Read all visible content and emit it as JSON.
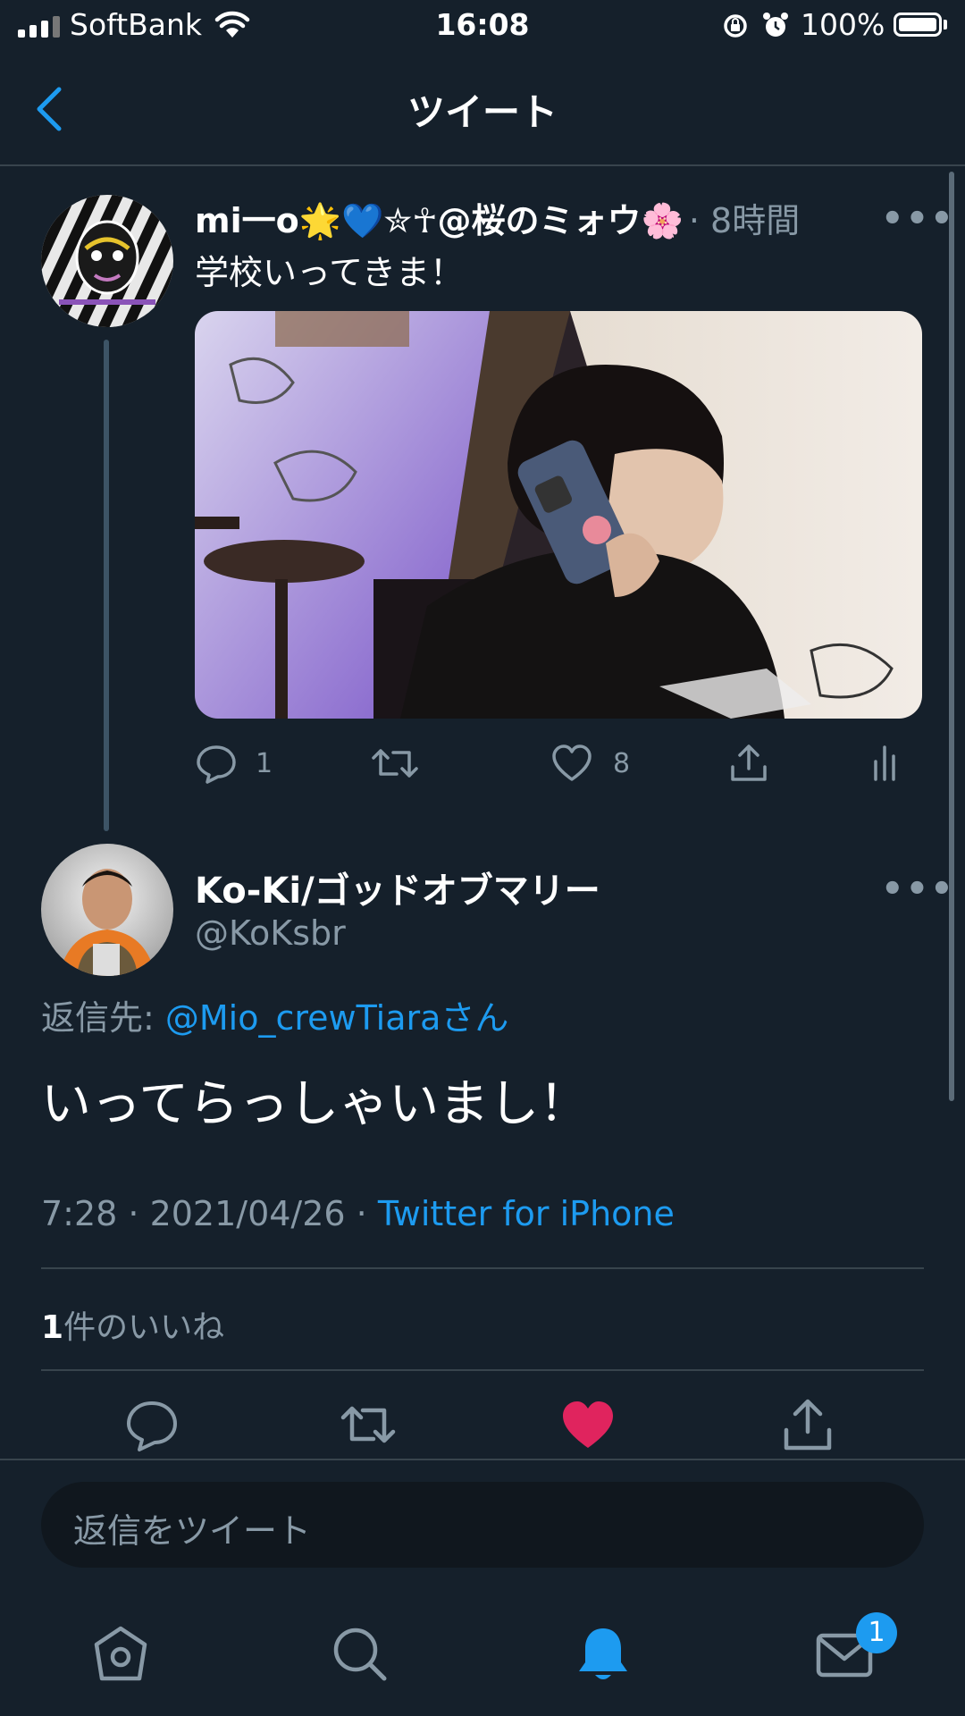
{
  "status_bar": {
    "carrier": "SoftBank",
    "time": "16:08",
    "battery": "100%"
  },
  "header": {
    "title": "ツイート"
  },
  "parent_tweet": {
    "display_name": "mi一o🌟💙✮☥@桜のミォウ🌸",
    "time_ago": "· 8時間",
    "text": "学校いってきま！",
    "reply_count": "1",
    "like_count": "8"
  },
  "main_tweet": {
    "display_name": "Ko-Ki/ゴッドオブマリー",
    "handle": "@KoKsbr",
    "reply_to_label": "返信先: ",
    "reply_to_user": "@Mio_crewTiaraさん",
    "text": "いってらっしゃいまし！",
    "timestamp": "7:28 · 2021/04/26 · ",
    "source": "Twitter for iPhone",
    "likes_count": "1",
    "likes_label": "件のいいね"
  },
  "reply_box": {
    "placeholder": "返信をツイート"
  },
  "tab_bar": {
    "messages_badge": "1"
  },
  "colors": {
    "background": "#15202b",
    "accent": "#1d9bf0",
    "like": "#e0245e",
    "muted": "#8899a6"
  }
}
